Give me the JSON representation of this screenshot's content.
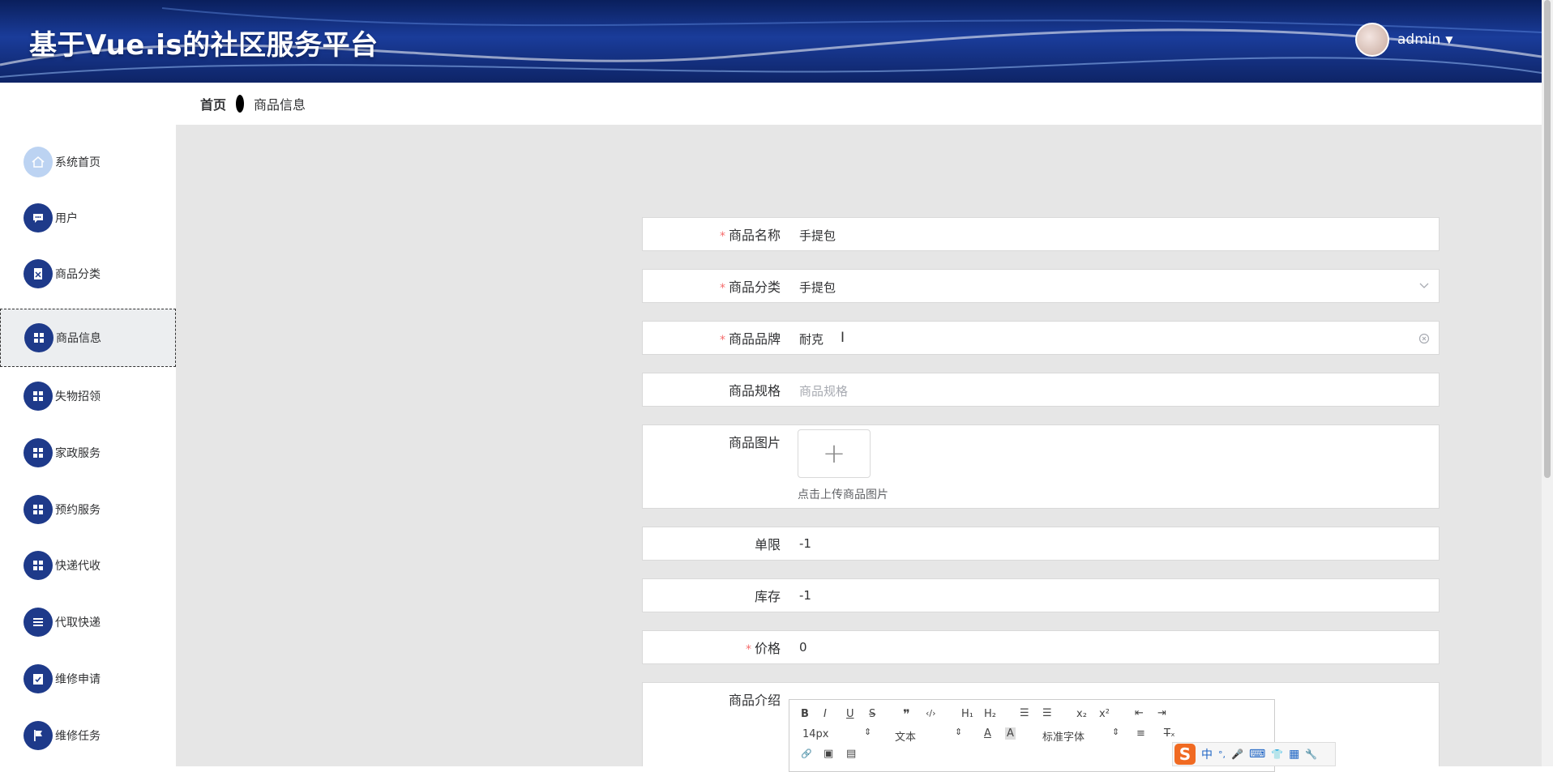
{
  "header": {
    "title": "基于Vue.is的社区服务平台",
    "username": "admin",
    "caret": "▼"
  },
  "breadcrumb": {
    "home": "首页",
    "current": "商品信息"
  },
  "sidebar": {
    "items": [
      {
        "label": "系统首页",
        "icon": "home-icon"
      },
      {
        "label": "用户",
        "icon": "chat-icon"
      },
      {
        "label": "商品分类",
        "icon": "document-icon"
      },
      {
        "label": "商品信息",
        "icon": "grid-icon",
        "active": true
      },
      {
        "label": "失物招领",
        "icon": "grid-icon"
      },
      {
        "label": "家政服务",
        "icon": "grid-icon"
      },
      {
        "label": "预约服务",
        "icon": "grid-icon"
      },
      {
        "label": "快递代收",
        "icon": "grid-icon"
      },
      {
        "label": "代取快递",
        "icon": "list-icon"
      },
      {
        "label": "维修申请",
        "icon": "clipboard-check-icon"
      },
      {
        "label": "维修任务",
        "icon": "flag-icon"
      }
    ]
  },
  "form": {
    "required_mark": "*",
    "name": {
      "label": "商品名称",
      "value": "手提包"
    },
    "category": {
      "label": "商品分类",
      "value": "手提包"
    },
    "brand": {
      "label": "商品品牌",
      "value": "耐克"
    },
    "spec": {
      "label": "商品规格",
      "placeholder": "商品规格"
    },
    "image": {
      "label": "商品图片",
      "tip": "点击上传商品图片",
      "plus": "+"
    },
    "limit": {
      "label": "单限",
      "value": "-1"
    },
    "stock": {
      "label": "库存",
      "value": "-1"
    },
    "price": {
      "label": "价格",
      "value": "0"
    },
    "intro": {
      "label": "商品介绍"
    }
  },
  "editor": {
    "bold": "B",
    "italic": "I",
    "underline": "U",
    "strike": "S",
    "quote": "❞",
    "code": "‹/›",
    "h1": "H₁",
    "h2": "H₂",
    "ol": "☰",
    "ul": "☰",
    "sub": "x₂",
    "sup": "x²",
    "indent_out": "⇤",
    "indent_in": "⇥",
    "font_size": "14px",
    "block_type": "文本",
    "color": "A",
    "bg": "A",
    "font_family": "标准字体",
    "align": "≡",
    "clear": "T̶ₓ",
    "link": "🔗",
    "image": "▣",
    "video": "▤"
  },
  "ime": {
    "logo": "S",
    "lang": "中",
    "punct": "°,",
    "mic": "🎤",
    "kbd": "⌨",
    "shirt": "👕",
    "apps": "▦",
    "tool": "🔧"
  }
}
